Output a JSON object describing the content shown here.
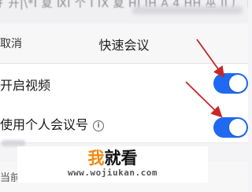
{
  "header": {
    "cancel_label": "取消",
    "title": "快速会议"
  },
  "settings": {
    "video": {
      "label": "开启视频",
      "enabled": true
    },
    "personal_meeting_id": {
      "label": "使用个人会议号",
      "info_icon": "info-icon",
      "enabled": true
    }
  },
  "bottom": {
    "label_partial": "当前"
  },
  "watermark": {
    "title_part1": "我",
    "title_part2": "就看",
    "url": "www.wojiukan.com"
  },
  "colors": {
    "toggle_on": "#1f6af0",
    "annotation_arrow": "#c62828",
    "watermark_accent": "#f08a14"
  }
}
